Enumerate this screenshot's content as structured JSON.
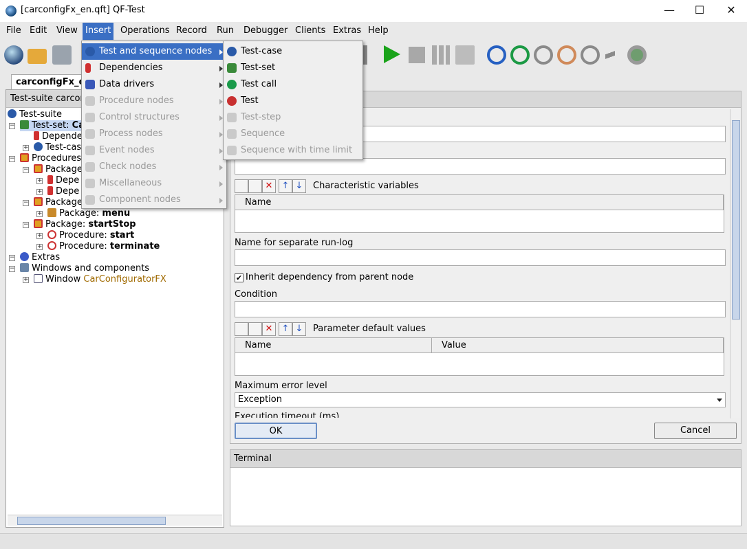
{
  "window": {
    "title": "[carconfigFx_en.qft] QF-Test"
  },
  "menubar": [
    "File",
    "Edit",
    "View",
    "Insert",
    "Operations",
    "Record",
    "Run",
    "Debugger",
    "Clients",
    "Extras",
    "Help"
  ],
  "insert_menu": [
    {
      "label": "Test and sequence nodes",
      "enabled": true,
      "highlighted": true,
      "icon": "test-suite-icon"
    },
    {
      "label": "Dependencies",
      "enabled": true,
      "icon": "dependency-icon"
    },
    {
      "label": "Data drivers",
      "enabled": true,
      "icon": "data-driver-icon"
    },
    {
      "label": "Procedure nodes",
      "enabled": false,
      "icon": "procedure-icon"
    },
    {
      "label": "Control structures",
      "enabled": false,
      "icon": "control-icon"
    },
    {
      "label": "Process nodes",
      "enabled": false,
      "icon": "process-icon"
    },
    {
      "label": "Event nodes",
      "enabled": false,
      "icon": "event-icon"
    },
    {
      "label": "Check nodes",
      "enabled": false,
      "icon": "check-icon"
    },
    {
      "label": "Miscellaneous",
      "enabled": false,
      "icon": "misc-icon"
    },
    {
      "label": "Component nodes",
      "enabled": false,
      "icon": "component-icon"
    }
  ],
  "submenu": [
    {
      "label": "Test-case",
      "enabled": true,
      "icon": "test-case-icon"
    },
    {
      "label": "Test-set",
      "enabled": true,
      "icon": "test-set-icon"
    },
    {
      "label": "Test call",
      "enabled": true,
      "icon": "test-call-icon"
    },
    {
      "label": "Test",
      "enabled": true,
      "icon": "test-icon"
    },
    {
      "label": "Test-step",
      "enabled": false,
      "icon": "test-step-icon"
    },
    {
      "label": "Sequence",
      "enabled": false,
      "icon": "sequence-icon"
    },
    {
      "label": "Sequence with time limit",
      "enabled": false,
      "icon": "timed-sequence-icon"
    }
  ],
  "left": {
    "tab": "carconfigFx_en.",
    "header": "Test-suite carconf",
    "tree": [
      {
        "text": "Test-suite",
        "bold": ""
      },
      {
        "text": "Test-set: ",
        "bold": "Ca"
      },
      {
        "text": "Depende",
        "bold": ""
      },
      {
        "text": "Test-cas",
        "bold": ""
      },
      {
        "text": "Procedures",
        "bold": ""
      },
      {
        "text": "Package",
        "bold": ""
      },
      {
        "text": "Depe",
        "bold": ""
      },
      {
        "text": "Depe",
        "bold": ""
      },
      {
        "text": "Package",
        "bold": ""
      },
      {
        "text": "Package: ",
        "bold": "menu"
      },
      {
        "text": "Package: ",
        "bold": "startStop"
      },
      {
        "text": "Procedure: ",
        "bold": "start"
      },
      {
        "text": "Procedure: ",
        "bold": "terminate"
      },
      {
        "text": "Extras",
        "bold": ""
      },
      {
        "text": "Windows and components",
        "bold": ""
      },
      {
        "text": "Window ",
        "colored": "CarConfiguratorFX"
      }
    ]
  },
  "right": {
    "char_vars_label": "Characteristic variables",
    "char_vars_col": "Name",
    "runlog_label": "Name for separate run-log",
    "inherit_label": "Inherit dependency from parent node",
    "condition_label": "Condition",
    "param_label": "Parameter default values",
    "param_cols": [
      "Name",
      "Value"
    ],
    "max_error_label": "Maximum error level",
    "max_error_value": "Exception",
    "exec_timeout_label": "Execution timeout (ms)",
    "ok": "OK",
    "cancel": "Cancel",
    "terminal": "Terminal"
  },
  "colors": {
    "accent": "#3a6fc4",
    "window_link": "#a06a00"
  }
}
